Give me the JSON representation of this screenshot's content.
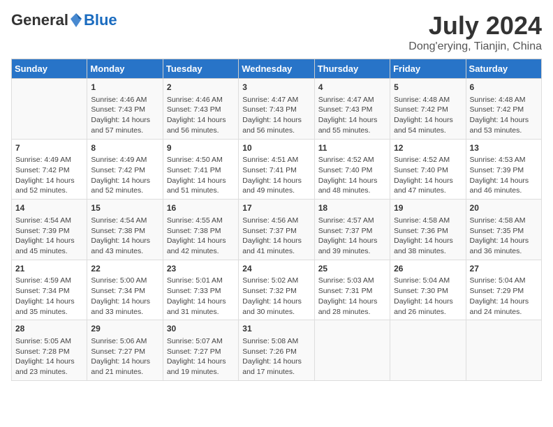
{
  "logo": {
    "general": "General",
    "blue": "Blue"
  },
  "title": "July 2024",
  "subtitle": "Dong'erying, Tianjin, China",
  "days": [
    "Sunday",
    "Monday",
    "Tuesday",
    "Wednesday",
    "Thursday",
    "Friday",
    "Saturday"
  ],
  "weeks": [
    [
      {
        "day": "",
        "content": ""
      },
      {
        "day": "1",
        "content": "Sunrise: 4:46 AM\nSunset: 7:43 PM\nDaylight: 14 hours\nand 57 minutes."
      },
      {
        "day": "2",
        "content": "Sunrise: 4:46 AM\nSunset: 7:43 PM\nDaylight: 14 hours\nand 56 minutes."
      },
      {
        "day": "3",
        "content": "Sunrise: 4:47 AM\nSunset: 7:43 PM\nDaylight: 14 hours\nand 56 minutes."
      },
      {
        "day": "4",
        "content": "Sunrise: 4:47 AM\nSunset: 7:43 PM\nDaylight: 14 hours\nand 55 minutes."
      },
      {
        "day": "5",
        "content": "Sunrise: 4:48 AM\nSunset: 7:42 PM\nDaylight: 14 hours\nand 54 minutes."
      },
      {
        "day": "6",
        "content": "Sunrise: 4:48 AM\nSunset: 7:42 PM\nDaylight: 14 hours\nand 53 minutes."
      }
    ],
    [
      {
        "day": "7",
        "content": "Sunrise: 4:49 AM\nSunset: 7:42 PM\nDaylight: 14 hours\nand 52 minutes."
      },
      {
        "day": "8",
        "content": "Sunrise: 4:49 AM\nSunset: 7:42 PM\nDaylight: 14 hours\nand 52 minutes."
      },
      {
        "day": "9",
        "content": "Sunrise: 4:50 AM\nSunset: 7:41 PM\nDaylight: 14 hours\nand 51 minutes."
      },
      {
        "day": "10",
        "content": "Sunrise: 4:51 AM\nSunset: 7:41 PM\nDaylight: 14 hours\nand 49 minutes."
      },
      {
        "day": "11",
        "content": "Sunrise: 4:52 AM\nSunset: 7:40 PM\nDaylight: 14 hours\nand 48 minutes."
      },
      {
        "day": "12",
        "content": "Sunrise: 4:52 AM\nSunset: 7:40 PM\nDaylight: 14 hours\nand 47 minutes."
      },
      {
        "day": "13",
        "content": "Sunrise: 4:53 AM\nSunset: 7:39 PM\nDaylight: 14 hours\nand 46 minutes."
      }
    ],
    [
      {
        "day": "14",
        "content": "Sunrise: 4:54 AM\nSunset: 7:39 PM\nDaylight: 14 hours\nand 45 minutes."
      },
      {
        "day": "15",
        "content": "Sunrise: 4:54 AM\nSunset: 7:38 PM\nDaylight: 14 hours\nand 43 minutes."
      },
      {
        "day": "16",
        "content": "Sunrise: 4:55 AM\nSunset: 7:38 PM\nDaylight: 14 hours\nand 42 minutes."
      },
      {
        "day": "17",
        "content": "Sunrise: 4:56 AM\nSunset: 7:37 PM\nDaylight: 14 hours\nand 41 minutes."
      },
      {
        "day": "18",
        "content": "Sunrise: 4:57 AM\nSunset: 7:37 PM\nDaylight: 14 hours\nand 39 minutes."
      },
      {
        "day": "19",
        "content": "Sunrise: 4:58 AM\nSunset: 7:36 PM\nDaylight: 14 hours\nand 38 minutes."
      },
      {
        "day": "20",
        "content": "Sunrise: 4:58 AM\nSunset: 7:35 PM\nDaylight: 14 hours\nand 36 minutes."
      }
    ],
    [
      {
        "day": "21",
        "content": "Sunrise: 4:59 AM\nSunset: 7:34 PM\nDaylight: 14 hours\nand 35 minutes."
      },
      {
        "day": "22",
        "content": "Sunrise: 5:00 AM\nSunset: 7:34 PM\nDaylight: 14 hours\nand 33 minutes."
      },
      {
        "day": "23",
        "content": "Sunrise: 5:01 AM\nSunset: 7:33 PM\nDaylight: 14 hours\nand 31 minutes."
      },
      {
        "day": "24",
        "content": "Sunrise: 5:02 AM\nSunset: 7:32 PM\nDaylight: 14 hours\nand 30 minutes."
      },
      {
        "day": "25",
        "content": "Sunrise: 5:03 AM\nSunset: 7:31 PM\nDaylight: 14 hours\nand 28 minutes."
      },
      {
        "day": "26",
        "content": "Sunrise: 5:04 AM\nSunset: 7:30 PM\nDaylight: 14 hours\nand 26 minutes."
      },
      {
        "day": "27",
        "content": "Sunrise: 5:04 AM\nSunset: 7:29 PM\nDaylight: 14 hours\nand 24 minutes."
      }
    ],
    [
      {
        "day": "28",
        "content": "Sunrise: 5:05 AM\nSunset: 7:28 PM\nDaylight: 14 hours\nand 23 minutes."
      },
      {
        "day": "29",
        "content": "Sunrise: 5:06 AM\nSunset: 7:27 PM\nDaylight: 14 hours\nand 21 minutes."
      },
      {
        "day": "30",
        "content": "Sunrise: 5:07 AM\nSunset: 7:27 PM\nDaylight: 14 hours\nand 19 minutes."
      },
      {
        "day": "31",
        "content": "Sunrise: 5:08 AM\nSunset: 7:26 PM\nDaylight: 14 hours\nand 17 minutes."
      },
      {
        "day": "",
        "content": ""
      },
      {
        "day": "",
        "content": ""
      },
      {
        "day": "",
        "content": ""
      }
    ]
  ]
}
